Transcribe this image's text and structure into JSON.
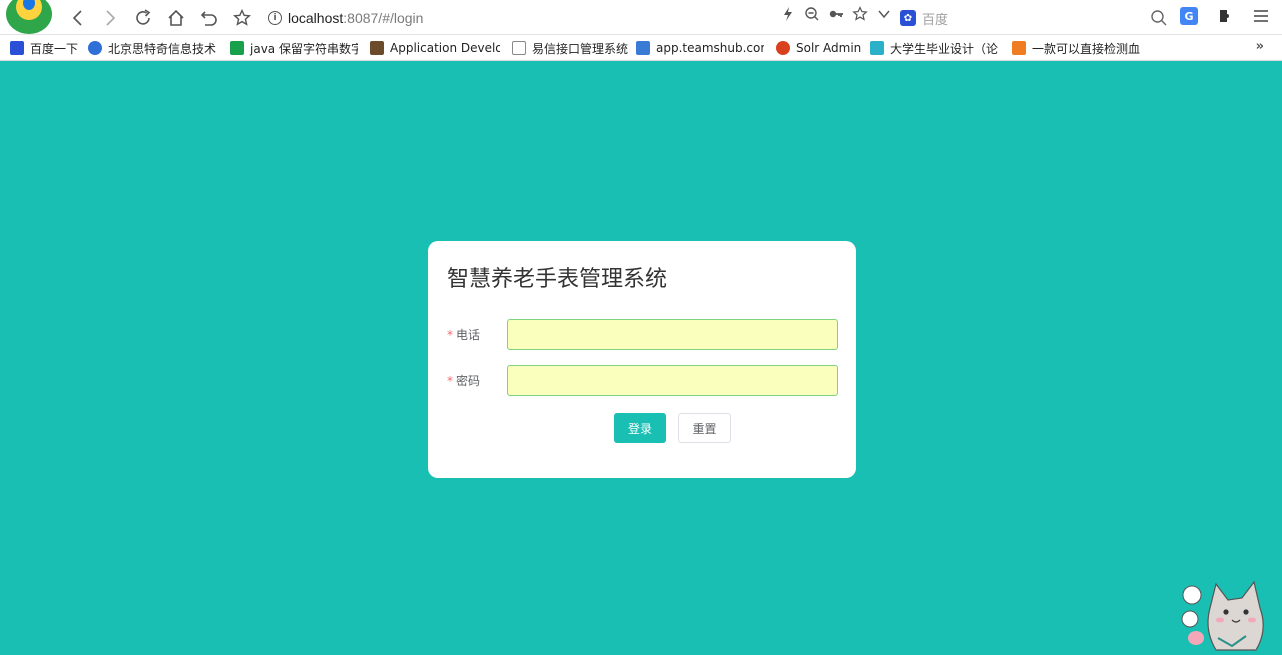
{
  "browser": {
    "url_host": "localhost",
    "url_rest": ":8087/#/login",
    "search_placeholder": "百度"
  },
  "bookmarks": [
    {
      "label": "百度一下",
      "icon": "baidu-paw-icon",
      "color": "#2a50d6"
    },
    {
      "label": "北京思特奇信息技术",
      "icon": "cloud-icon",
      "color": "#2f6fd6"
    },
    {
      "label": "java 保留字符串数字",
      "icon": "evernote-icon",
      "color": "#19a04b"
    },
    {
      "label": "Application Develop",
      "icon": "image-icon",
      "color": "#6b4b2a"
    },
    {
      "label": "易信接口管理系统",
      "icon": "page-icon",
      "color": "#888888"
    },
    {
      "label": "app.teamshub.com",
      "icon": "picture-icon",
      "color": "#3a7bd5"
    },
    {
      "label": "Solr Admin",
      "icon": "solr-icon",
      "color": "#d9411e"
    },
    {
      "label": "大学生毕业设计（论",
      "icon": "grad-icon",
      "color": "#2ab0c9"
    },
    {
      "label": "一款可以直接检测血",
      "icon": "csdn-icon",
      "color": "#f07c22"
    }
  ],
  "login": {
    "title": "智慧养老手表管理系统",
    "phone_label": "电话",
    "password_label": "密码",
    "required_mark": "*",
    "phone_value": "",
    "password_value": "",
    "login_button": "登录",
    "reset_button": "重置"
  },
  "colors": {
    "page_background": "#1abfb4",
    "primary": "#1abfb4",
    "autofill": "#faffbd"
  }
}
